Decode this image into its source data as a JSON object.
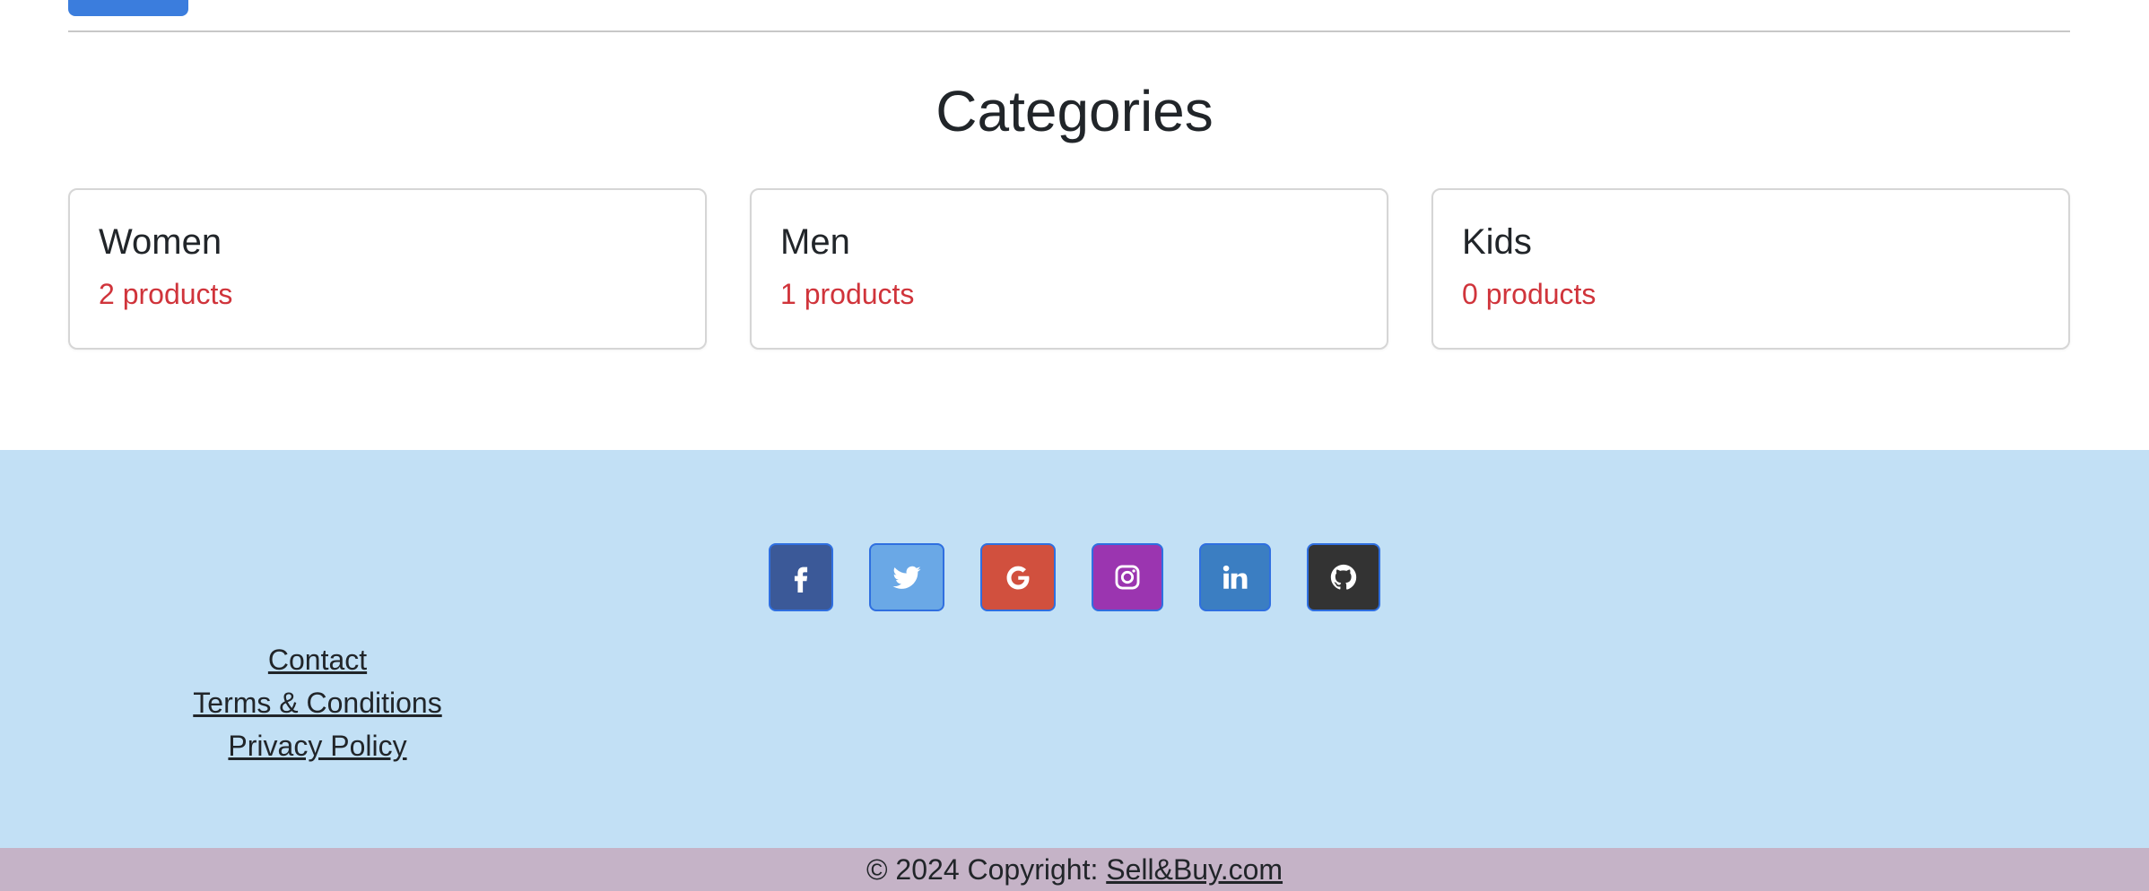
{
  "categories": {
    "title": "Categories",
    "items": [
      {
        "name": "Women",
        "count": "2 products"
      },
      {
        "name": "Men",
        "count": "1 products"
      },
      {
        "name": "Kids",
        "count": "0 products"
      }
    ]
  },
  "footer": {
    "social": [
      {
        "icon": "facebook-icon",
        "color": "#3b5998"
      },
      {
        "icon": "twitter-icon",
        "color": "#6aa8e6"
      },
      {
        "icon": "google-icon",
        "color": "#d1503e"
      },
      {
        "icon": "instagram-icon",
        "color": "#9b35b0"
      },
      {
        "icon": "linkedin-icon",
        "color": "#3b7ec2"
      },
      {
        "icon": "github-icon",
        "color": "#333333"
      }
    ],
    "links": [
      "Contact",
      "Terms & Conditions",
      "Privacy Policy"
    ],
    "copyright_prefix": "© 2024 Copyright: ",
    "copyright_link": "Sell&Buy.com",
    "background": "#c2e0f5",
    "copyright_background": "#c5b3c7"
  },
  "colors": {
    "accent": "#3b7ddd",
    "count_text": "#d0343b"
  }
}
